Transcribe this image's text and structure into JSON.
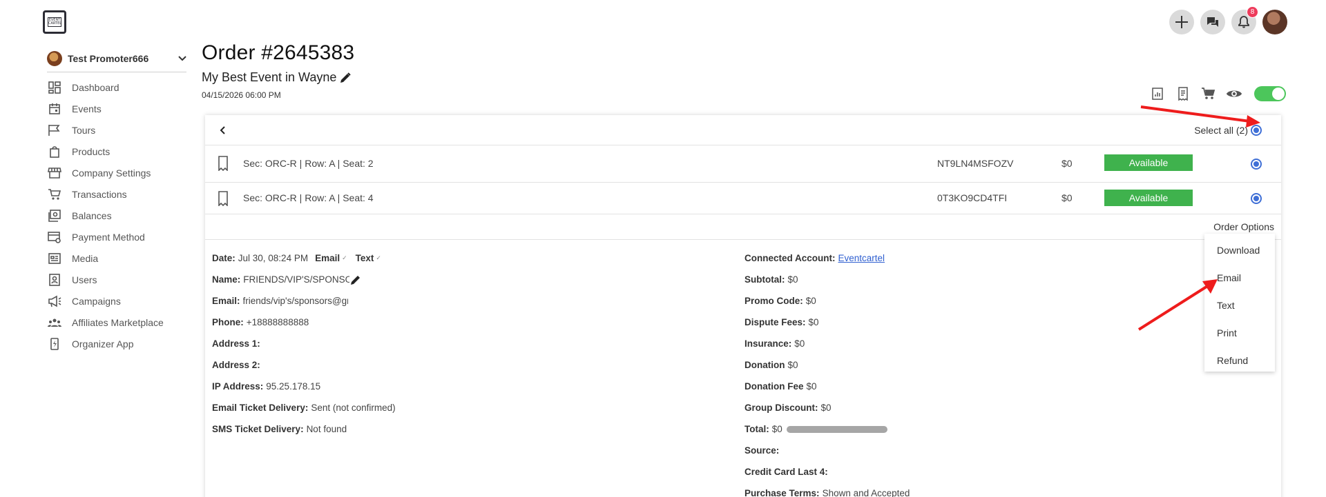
{
  "brand": {
    "logo_text": "EVENT CARTEL"
  },
  "top_actions": {
    "notification_count": "8"
  },
  "sidebar": {
    "org_name": "Test Promoter666",
    "items": [
      {
        "label": "Dashboard",
        "icon": "dashboard-icon"
      },
      {
        "label": "Events",
        "icon": "calendar-icon"
      },
      {
        "label": "Tours",
        "icon": "flag-icon"
      },
      {
        "label": "Products",
        "icon": "bag-icon"
      },
      {
        "label": "Company Settings",
        "icon": "store-icon"
      },
      {
        "label": "Transactions",
        "icon": "cart-icon"
      },
      {
        "label": "Balances",
        "icon": "money-icon"
      },
      {
        "label": "Payment Method",
        "icon": "card-settings-icon"
      },
      {
        "label": "Media",
        "icon": "media-icon"
      },
      {
        "label": "Users",
        "icon": "user-badge-icon"
      },
      {
        "label": "Campaigns",
        "icon": "megaphone-icon"
      },
      {
        "label": "Affiliates Marketplace",
        "icon": "group-icon"
      },
      {
        "label": "Organizer App",
        "icon": "phone-icon"
      }
    ]
  },
  "header": {
    "order_title": "Order #2645383",
    "event_name": "My Best Event in Wayne",
    "event_date": "04/15/2026 06:00 PM"
  },
  "tickets": {
    "select_all_label": "Select all (2)",
    "rows": [
      {
        "seat": "Sec: ORC-R | Row: A | Seat: 2",
        "code": "NT9LN4MSFOZV",
        "price": "$0",
        "status": "Available",
        "selected": true
      },
      {
        "seat": "Sec: ORC-R | Row: A | Seat: 4",
        "code": "0T3KO9CD4TFI",
        "price": "$0",
        "status": "Available",
        "selected": true
      }
    ]
  },
  "order_options": {
    "label": "Order Options",
    "items": [
      "Download",
      "Email",
      "Text",
      "Print",
      "Refund"
    ]
  },
  "details_left": {
    "date_label": "Date:",
    "date_value": "Jul 30, 08:24 PM",
    "email_action": "Email",
    "text_action": "Text",
    "name_label": "Name:",
    "name_value": "FRIENDS/VIP'S/SPONSORS",
    "email_label": "Email:",
    "email_value": "friends/vip's/sponsors@gmail.com",
    "phone_label": "Phone:",
    "phone_value": "+18888888888",
    "address1_label": "Address 1:",
    "address1_value": "",
    "address2_label": "Address 2:",
    "address2_value": "",
    "ip_label": "IP Address:",
    "ip_value": "95.25.178.15",
    "email_delivery_label": "Email Ticket Delivery:",
    "email_delivery_value": "Sent (not confirmed)",
    "sms_delivery_label": "SMS Ticket Delivery:",
    "sms_delivery_value": "Not found"
  },
  "details_right": {
    "connected_label": "Connected Account:",
    "connected_value": "Eventcartel",
    "subtotal_label": "Subtotal:",
    "subtotal_value": "$0",
    "promo_label": "Promo Code:",
    "promo_value": "$0",
    "dispute_label": "Dispute Fees:",
    "dispute_value": "$0",
    "insurance_label": "Insurance:",
    "insurance_value": "$0",
    "donation_label": "Donation",
    "donation_value": "$0",
    "donation_fee_label": "Donation Fee",
    "donation_fee_value": "$0",
    "group_discount_label": "Group Discount:",
    "group_discount_value": "$0",
    "total_label": "Total:",
    "total_value": "$0",
    "source_label": "Source:",
    "source_value": "",
    "cc_label": "Credit Card Last 4:",
    "cc_value": "",
    "terms_label": "Purchase Terms:",
    "terms_value": "Shown and Accepted"
  },
  "colors": {
    "accent_blue": "#3f6fd6",
    "available_green": "#3fb24d",
    "toggle_green": "#4cc65b",
    "badge_red": "#ee3b5b",
    "annotation_red": "#ee1c1c"
  }
}
